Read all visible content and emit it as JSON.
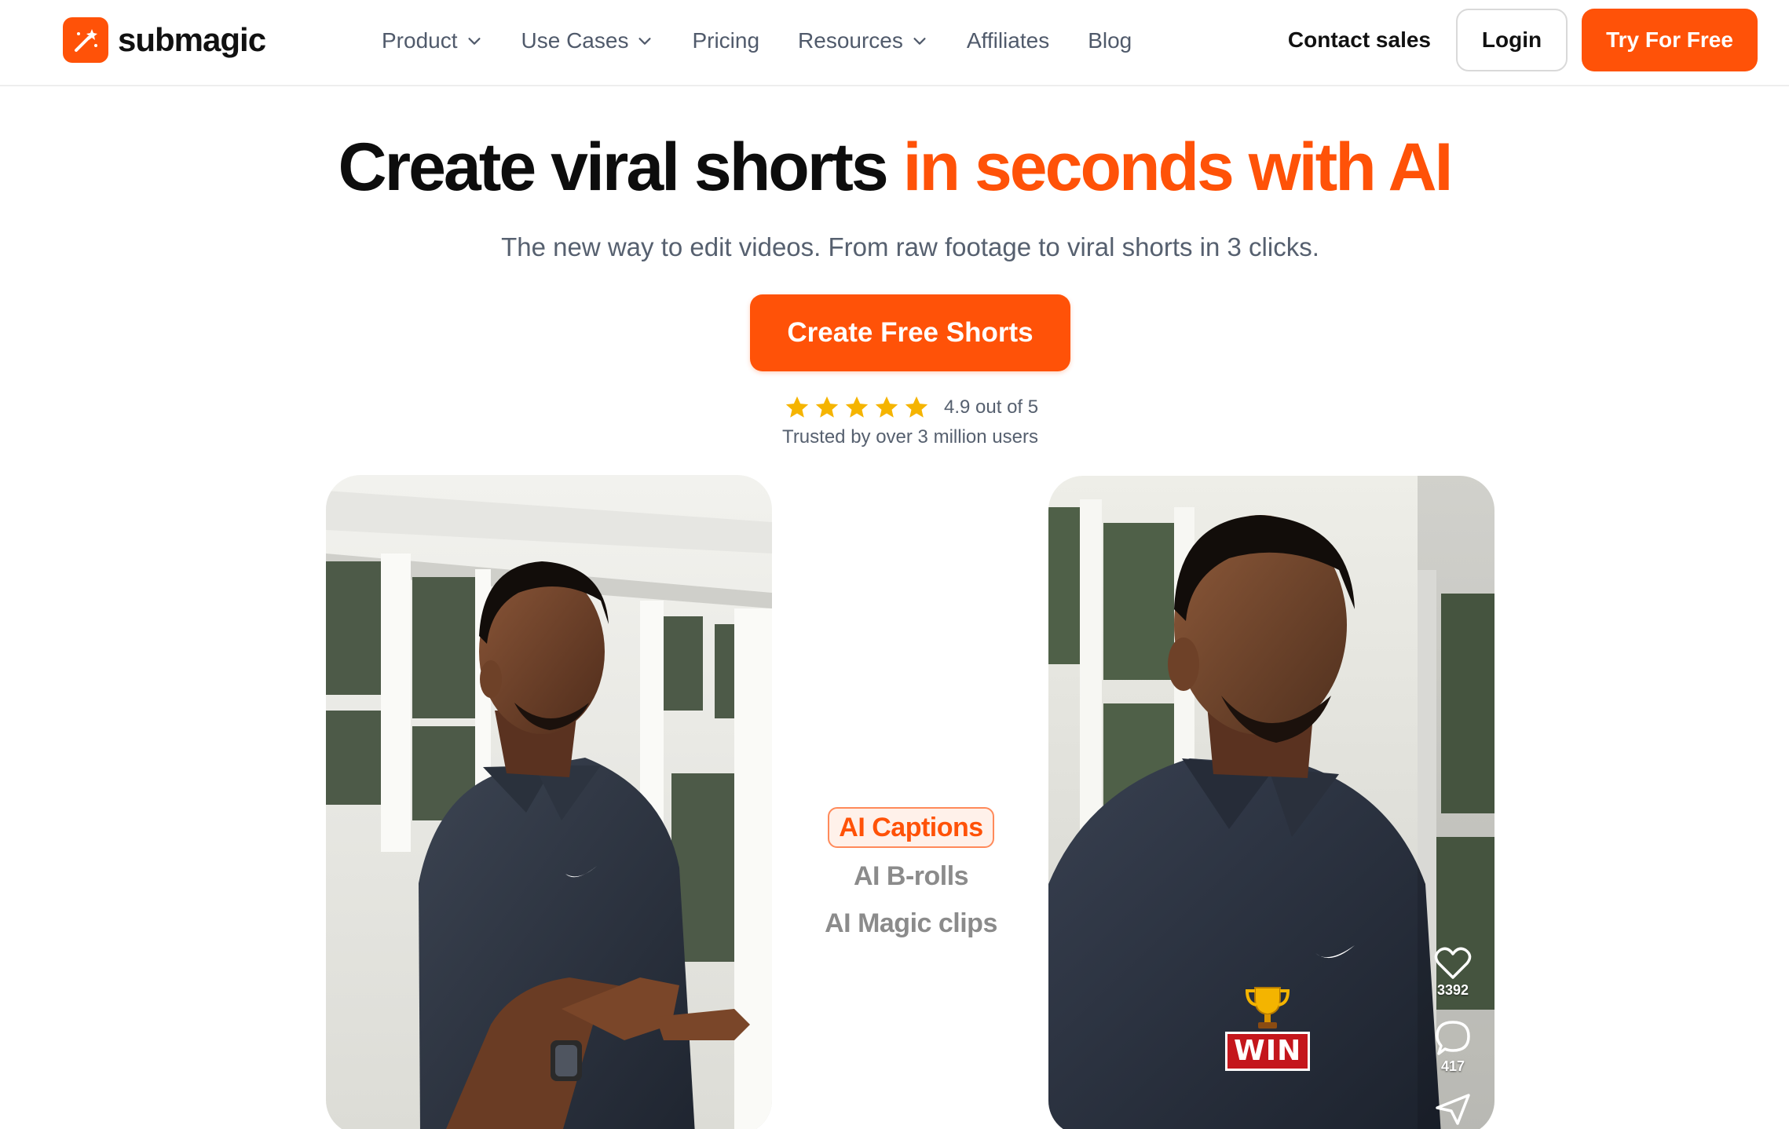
{
  "nav": {
    "logo_text": "submagic",
    "menu": [
      {
        "label": "Product",
        "has_dropdown": true
      },
      {
        "label": "Use Cases",
        "has_dropdown": true
      },
      {
        "label": "Pricing",
        "has_dropdown": false
      },
      {
        "label": "Resources",
        "has_dropdown": true
      },
      {
        "label": "Affiliates",
        "has_dropdown": false
      },
      {
        "label": "Blog",
        "has_dropdown": false
      }
    ],
    "contact_label": "Contact sales",
    "login_label": "Login",
    "try_label": "Try For Free"
  },
  "hero": {
    "title_main": "Create viral shorts ",
    "title_accent": "in seconds with AI",
    "subtitle": "The new way to edit videos. From raw footage to viral shorts in 3 clicks.",
    "cta_label": "Create Free Shorts",
    "rating_stars": 5,
    "rating_text": "4.9 out of 5",
    "trusted_text": "Trusted by over 3 million users"
  },
  "features": {
    "items": [
      {
        "label": "AI Captions",
        "active": true
      },
      {
        "label": "AI B-rolls",
        "active": false
      },
      {
        "label": "AI Magic clips",
        "active": false
      }
    ]
  },
  "preview": {
    "likes": "3392",
    "comments": "417",
    "caption_badge": "WIN"
  },
  "colors": {
    "brand": "#ff5208",
    "text": "#0d0d0d",
    "muted": "#56606f",
    "star": "#f5b400"
  }
}
